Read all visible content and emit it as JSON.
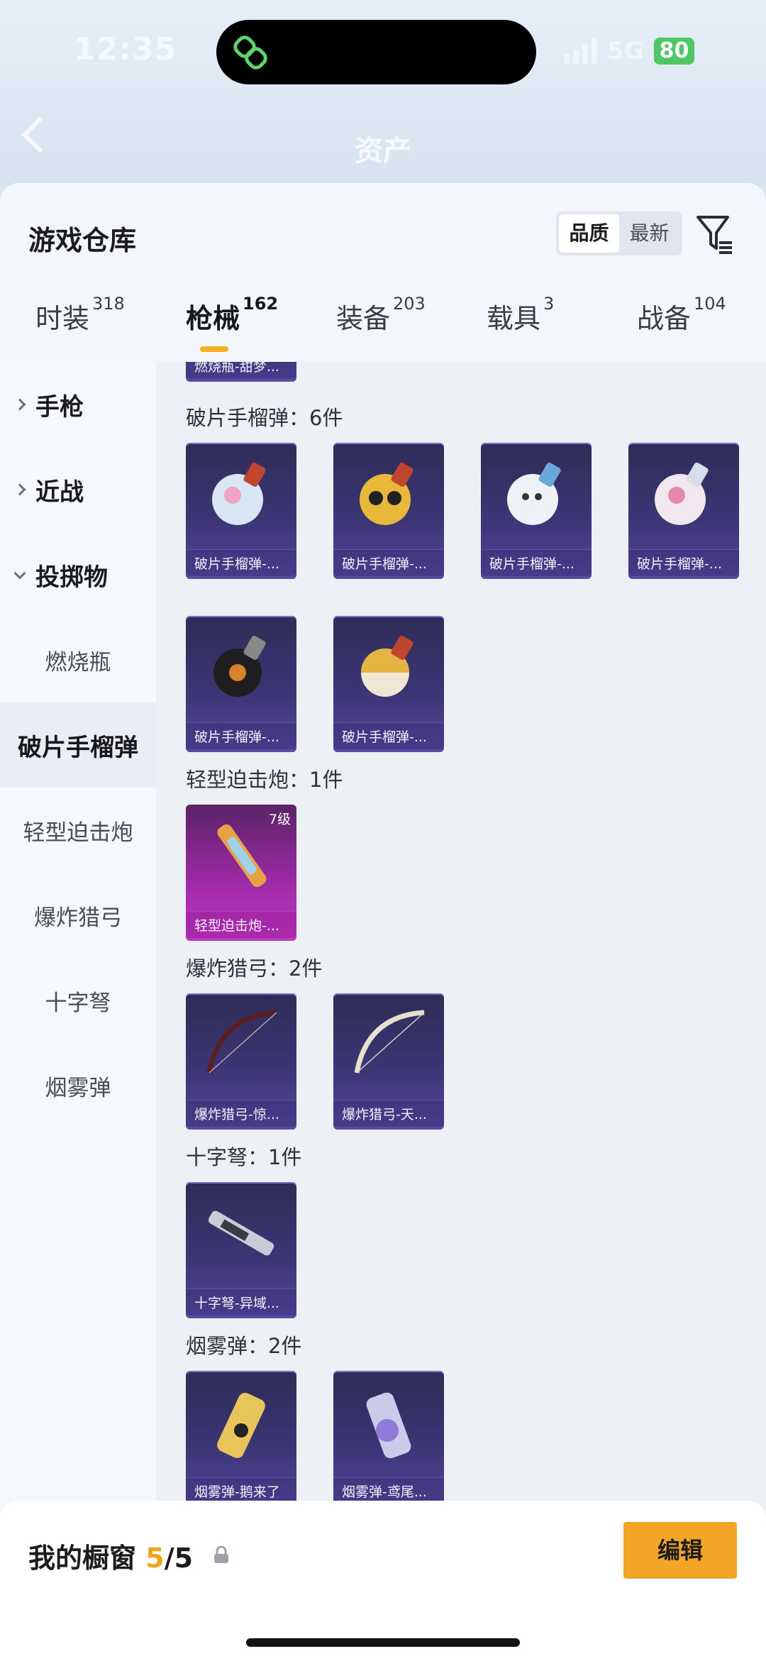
{
  "status": {
    "time": "12:35",
    "network": "5G",
    "battery": "80"
  },
  "nav": {
    "title": "资产"
  },
  "warehouse": {
    "title": "游戏仓库",
    "sort_options": [
      "品质",
      "最新"
    ],
    "active_sort": "品质"
  },
  "tabs": [
    {
      "label": "时装",
      "count": "318"
    },
    {
      "label": "枪械",
      "count": "162"
    },
    {
      "label": "装备",
      "count": "203"
    },
    {
      "label": "载具",
      "count": "3"
    },
    {
      "label": "战备",
      "count": "104"
    }
  ],
  "sidebar": {
    "categories": [
      {
        "label": "手枪",
        "state": "collapsed"
      },
      {
        "label": "近战",
        "state": "collapsed"
      },
      {
        "label": "投掷物",
        "state": "expanded"
      }
    ],
    "subitems": [
      "燃烧瓶",
      "破片手榴弹",
      "轻型迫击炮",
      "爆炸猎弓",
      "十字弩",
      "烟雾弹"
    ],
    "active": "破片手榴弹"
  },
  "content": {
    "prev_item": "燃烧瓶-甜梦...",
    "groups": [
      {
        "label": "破片手榴弹：6件",
        "items": [
          "破片手榴弹-...",
          "破片手榴弹-...",
          "破片手榴弹-...",
          "破片手榴弹-...",
          "破片手榴弹-...",
          "破片手榴弹-..."
        ]
      },
      {
        "label": "轻型迫击炮：1件",
        "items": [
          "轻型迫击炮-..."
        ],
        "level": "7级"
      },
      {
        "label": "爆炸猎弓：2件",
        "items": [
          "爆炸猎弓-惊...",
          "爆炸猎弓-天..."
        ]
      },
      {
        "label": "十字弩：1件",
        "items": [
          "十字弩-异域..."
        ]
      },
      {
        "label": "烟雾弹：2件",
        "items": [
          "烟雾弹-鹅来了",
          "烟雾弹-鸢尾..."
        ]
      }
    ]
  },
  "showcase": {
    "label": "我的橱窗",
    "current": "5",
    "total": "/5",
    "edit_label": "编辑"
  }
}
